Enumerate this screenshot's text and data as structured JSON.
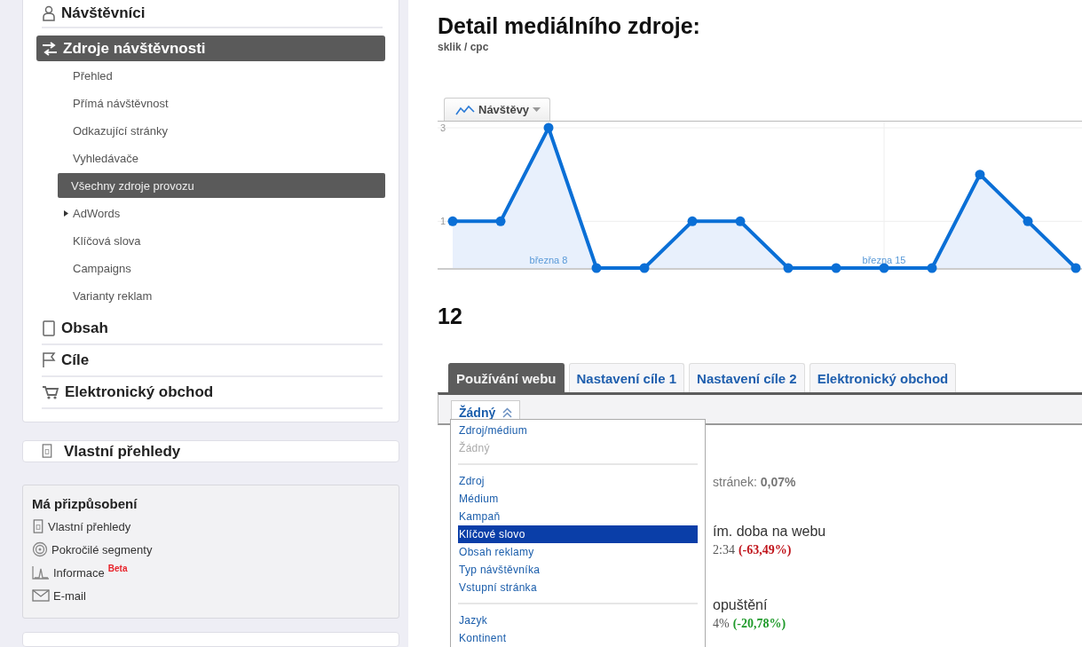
{
  "sidebar": {
    "sections": [
      {
        "label": "Návštěvníci",
        "selected": false
      },
      {
        "label": "Zdroje návštěvnosti",
        "selected": true,
        "children": [
          {
            "label": "Přehled",
            "selected": false
          },
          {
            "label": "Přímá návštěvnost",
            "selected": false
          },
          {
            "label": "Odkazující stránky",
            "selected": false
          },
          {
            "label": "Vyhledávače",
            "selected": false
          },
          {
            "label": "Všechny zdroje provozu",
            "selected": true
          },
          {
            "label": "AdWords",
            "selected": false,
            "expanded": false
          },
          {
            "label": "Klíčová slova",
            "selected": false
          },
          {
            "label": "Campaigns",
            "selected": false
          },
          {
            "label": "Varianty reklam",
            "selected": false
          }
        ]
      },
      {
        "label": "Obsah",
        "selected": false
      },
      {
        "label": "Cíle",
        "selected": false
      },
      {
        "label": "Elektronický obchod",
        "selected": false
      }
    ],
    "custom_reports": {
      "label": "Vlastní přehledy"
    },
    "customization": {
      "title": "Má přizpůsobení",
      "items": [
        {
          "label": "Vlastní přehledy"
        },
        {
          "label": "Pokročilé segmenty"
        },
        {
          "label": "Informace",
          "badge": "Beta"
        },
        {
          "label": "E-mail"
        }
      ]
    }
  },
  "main": {
    "title": "Detail mediálního zdroje:",
    "subtitle": "sklik / cpc",
    "metric_selector": {
      "label": "Návštěvy"
    },
    "chart_data": {
      "type": "area",
      "categories": [
        null,
        null,
        "března 8",
        null,
        null,
        null,
        null,
        null,
        null,
        "března 15",
        null,
        null,
        null,
        null
      ],
      "yticks": [
        {
          "value": 1,
          "label": "1"
        },
        {
          "value": 3,
          "label": "3"
        }
      ],
      "ylim": [
        0,
        3
      ],
      "grid": true,
      "series": [
        {
          "color": "#0a6fd6",
          "marker": "circle",
          "values": [
            1,
            1,
            3,
            0,
            0,
            1,
            1,
            0,
            0,
            0,
            0,
            2,
            1,
            0
          ]
        }
      ]
    },
    "total": "12",
    "tabs": [
      {
        "label": "Používání webu",
        "selected": true
      },
      {
        "label": "Nastavení cíle 1",
        "selected": false
      },
      {
        "label": "Nastavení cíle 2",
        "selected": false
      },
      {
        "label": "Elektronický obchod",
        "selected": false
      }
    ],
    "segment_dropdown": {
      "value": "Žádný",
      "expanded": true
    },
    "dropdown_menu": {
      "groups": [
        [
          {
            "label": "Zdroj/médium",
            "disabled": false,
            "selected": false
          },
          {
            "label": "Žádný",
            "disabled": true,
            "selected": false
          }
        ],
        [
          {
            "label": "Zdroj",
            "disabled": false,
            "selected": false
          },
          {
            "label": "Médium",
            "disabled": false,
            "selected": false
          },
          {
            "label": "Kampaň",
            "disabled": false,
            "selected": false
          },
          {
            "label": "Klíčové slovo",
            "disabled": false,
            "selected": true
          },
          {
            "label": "Obsah reklamy",
            "disabled": false,
            "selected": false
          },
          {
            "label": "Typ návštěvníka",
            "disabled": false,
            "selected": false
          },
          {
            "label": "Vstupní stránka",
            "disabled": false,
            "selected": false
          }
        ],
        [
          {
            "label": "Jazyk",
            "disabled": false,
            "selected": false
          },
          {
            "label": "Kontinent",
            "disabled": false,
            "selected": false
          }
        ]
      ]
    },
    "metrics": [
      {
        "label": "stránek: **0,07%**"
      },
      {
        "label": "ím. doba na webu",
        "value": "2:34",
        "change": "(-63,49%)",
        "color": "#c0141b"
      },
      {
        "label": "opuštění",
        "value": "4%",
        "change": "(-20,78%)",
        "color": "#1f9a2a"
      }
    ]
  }
}
